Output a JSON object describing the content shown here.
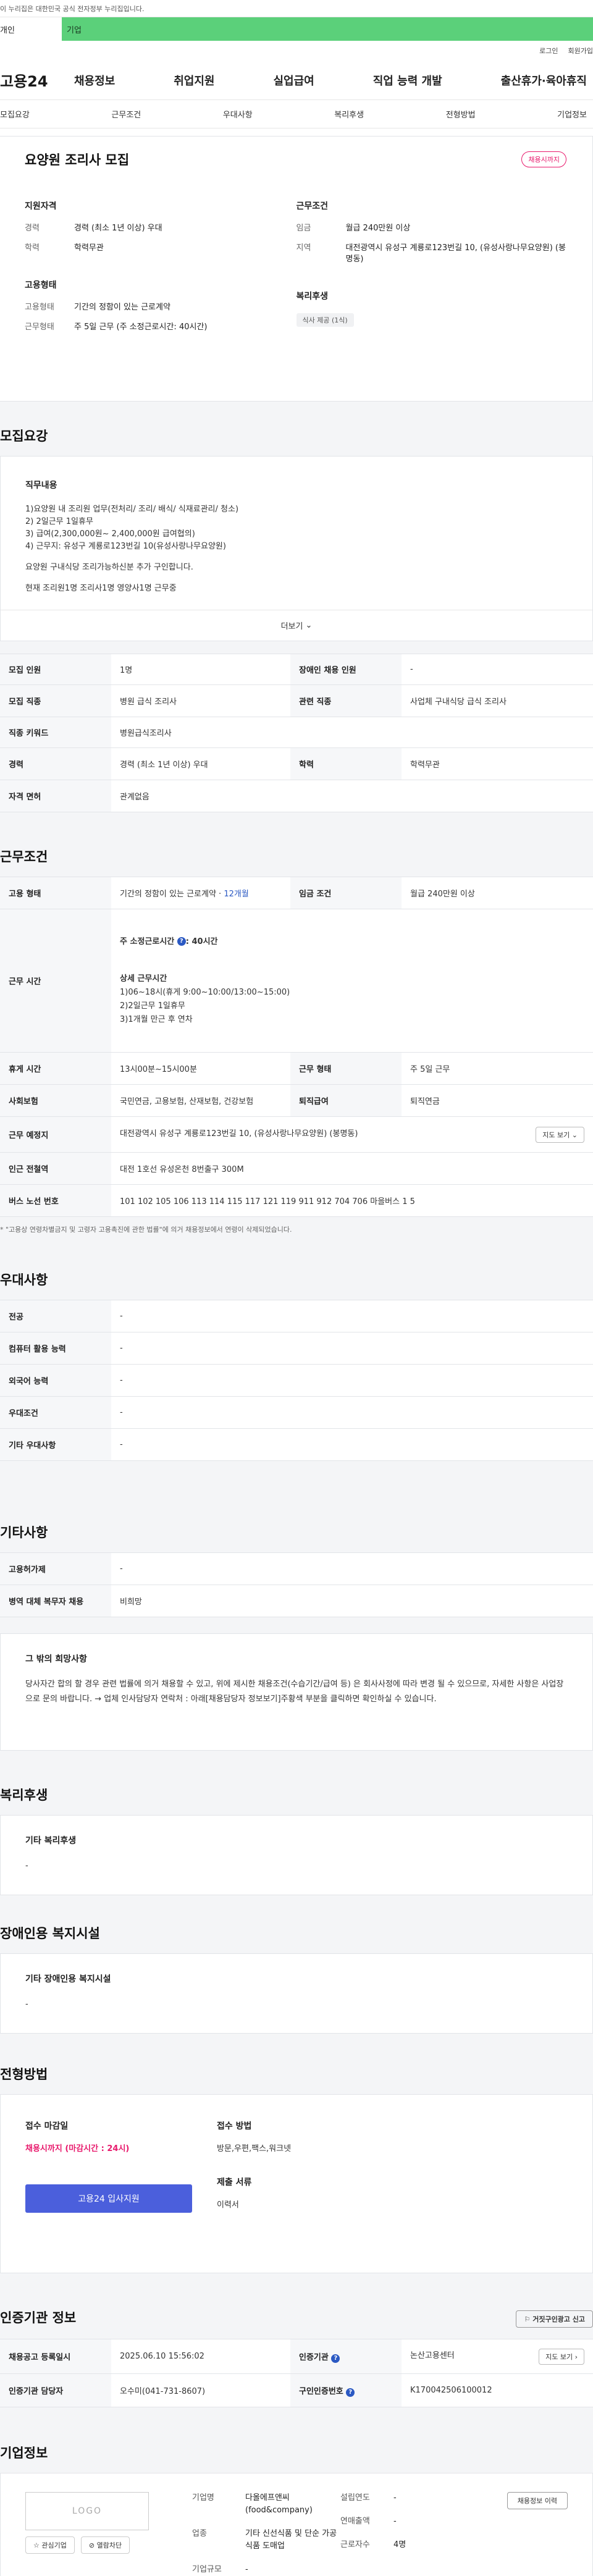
{
  "gov_banner": "이 누리집은 대한민국 공식 전자정부 누리집입니다.",
  "user_tabs": {
    "personal": "개인",
    "company": "기업"
  },
  "utility": {
    "login": "로그인",
    "signup": "회원가입"
  },
  "header": {
    "logo": "고용24",
    "menu": [
      "채용정보",
      "취업지원",
      "실업급여",
      "직업 능력 개발",
      "출산휴가·육아휴직"
    ]
  },
  "anchor_tabs": [
    "모집요강",
    "근무조건",
    "우대사항",
    "복리후생",
    "전형방법",
    "기업정보"
  ],
  "summary": {
    "title": "요양원 조리사 모집",
    "deadline_badge": "채용시까지",
    "qualification": {
      "head": "지원자격",
      "career_label": "경력",
      "career_val": "경력 (최소 1년 이상) 우대",
      "edu_label": "학력",
      "edu_val": "학력무관"
    },
    "employment": {
      "head": "고용형태",
      "type_label": "고용형태",
      "type_val": "기간의 정함이 있는 근로계약",
      "hours_label": "근무형태",
      "hours_val": "주 5일 근무 (주 소정근로시간: 40시간)"
    },
    "conditions": {
      "head": "근무조건",
      "wage_label": "임금",
      "wage_val": "월급 240만원 이상",
      "loc_label": "지역",
      "loc_val": "대전광역시 유성구 계룡로123번길 10, (유성사랑나무요양원) (봉명동)"
    },
    "welfare": {
      "head": "복리후생",
      "chip": "식사 제공 (1식)"
    }
  },
  "recruit": {
    "title": "모집요강",
    "duty_head": "직무내용",
    "lines": [
      "1)요양원 내 조리원 업무(전처리/ 조리/ 배식/ 식재료관리/ 청소)",
      "2) 2일근무 1일휴무",
      "3) 급여(2,300,000원~ 2,400,000원 급여협의)",
      "4) 근무지: 유성구 계룡로123번길 10(유성사랑나무요양원)",
      "",
      "요양원 구내식당 조리가능하신분 추가 구인합니다.",
      "",
      "현재 조리원1명 조리사1명 영양사1명 근무중"
    ],
    "more": "더보기"
  },
  "recruit_table": {
    "r1": {
      "l1": "모집 인원",
      "v1": "1명",
      "l2": "장애인 채용 인원",
      "v2": "-"
    },
    "r2": {
      "l1": "모집 직종",
      "v1": "병원 급식 조리사",
      "l2": "관련 직종",
      "v2": "사업체 구내식당 급식 조리사"
    },
    "r3": {
      "l1": "직종 키워드",
      "v1": "병원급식조리사"
    },
    "r4": {
      "l1": "경력",
      "v1": "경력 (최소 1년 이상) 우대",
      "l2": "학력",
      "v2": "학력무관"
    },
    "r5": {
      "l1": "자격 면허",
      "v1": "관계없음"
    }
  },
  "work": {
    "title": "근무조건",
    "type_label": "고용 형태",
    "type_val": "기간의 정함이 있는 근로계약 · ",
    "type_months": "12개월",
    "wage_label": "임금 조건",
    "wage_val": "월급 240만원 이상",
    "time_label": "근무 시간",
    "weekly_hours": "주 소정근로시간 ",
    "weekly_hours_val": ": 40시간",
    "detail_head": "상세 근무시간",
    "detail_lines": [
      "1)06~18시(휴게 9:00~10:00/13:00~15:00)",
      "2)2일근무 1일휴무",
      "3)1개월 만근 후 연차"
    ],
    "break_label": "휴게 시간",
    "break_val": "13시00분~15시00분",
    "form_label": "근무 형태",
    "form_val": "주 5일 근무",
    "ins_label": "사회보험",
    "ins_val": "국민연금, 고용보험, 산재보험, 건강보험",
    "ret_label": "퇴직급여",
    "ret_val": "퇴직연금",
    "place_label": "근무 예정지",
    "place_val": "대전광역시 유성구 계룡로123번길 10, (유성사랑나무요양원) (봉명동)",
    "map_btn": "지도 보기",
    "subway_label": "인근 전철역",
    "subway_val": "대전 1호선 유성온천 8번출구 300M",
    "bus_label": "버스 노선 번호",
    "bus_val": "101 102 105 106 113 114 115 117 121 119 911 912 704 706 마을버스 1 5",
    "note": "* \"고용상 연령차별금지 및 고령자 고용촉진에 관한 법률\"에 의거 채용정보에서 연령이 삭제되었습니다."
  },
  "prefer": {
    "title": "우대사항",
    "rows": [
      {
        "label": "전공",
        "val": "-"
      },
      {
        "label": "컴퓨터 활용 능력",
        "val": "-"
      },
      {
        "label": "외국어 능력",
        "val": "-"
      },
      {
        "label": "우대조건",
        "val": "-"
      },
      {
        "label": "기타 우대사항",
        "val": "-"
      }
    ]
  },
  "etc": {
    "title": "기타사항",
    "rows": [
      {
        "label": "고용허가제",
        "val": "-"
      },
      {
        "label": "병역 대체 복무자 채용",
        "val": "비희망"
      }
    ],
    "other_head": "그 밖의 희망사항",
    "other_body": "당사자간 합의 할 경우 관련 법률에 의거 채용할 수 있고, 위에 제시한 채용조건(수습기간/급여 등) 은 회사사정에 따라 변경 될 수 있으므로, 자세한 사항은 사업장으로 문의 바랍니다. → 업체 인사담당자 연락처 : 아래[채용담당자 정보보기]주황색 부분을 클릭하면 확인하실 수 있습니다."
  },
  "welfare": {
    "title": "복리후생",
    "head": "기타 복리후생",
    "val": "-"
  },
  "disabled": {
    "title": "장애인용 복지시설",
    "head": "기타 장애인용 복지시설",
    "val": "-"
  },
  "apply": {
    "title": "전형방법",
    "deadline_head": "접수 마감일",
    "deadline_val": "채용시까지 (마감시간 : 24시)",
    "button": "고용24 입사지원",
    "method_head": "접수 방법",
    "method_val": "방문,우편,팩스,워크넷",
    "doc_head": "제출 서류",
    "doc_val": "이력서"
  },
  "agency": {
    "title": "인증기관 정보",
    "report": "거짓구인광고 신고",
    "reg_label": "채용공고 등록일시",
    "reg_val": "2025.06.10 15:56:02",
    "org_label": "인증기관",
    "org_val": "논산고용센터",
    "map_btn": "지도 보기",
    "mgr_label": "인증기관 담당자",
    "mgr_val": "오수미(041-731-8607)",
    "auth_label": "구인인증번호",
    "auth_val": "K170042506100012"
  },
  "company": {
    "title": "기업정보",
    "logo": "LOGO",
    "interest_btn": "관심기업",
    "block_btn": "열람차단",
    "name_label": "기업명",
    "name_val": "다올에프앤씨(food&company)",
    "industry_label": "업종",
    "industry_val": "기타 신선식품 및 단순 가공식품 도매업",
    "scale_label": "기업규모",
    "scale_val": "-",
    "found_label": "설립연도",
    "found_val": "-",
    "sales_label": "연매출액",
    "sales_val": "-",
    "emp_label": "근로자수",
    "emp_val": "4명",
    "hire_btn": "채용정보 이력"
  }
}
